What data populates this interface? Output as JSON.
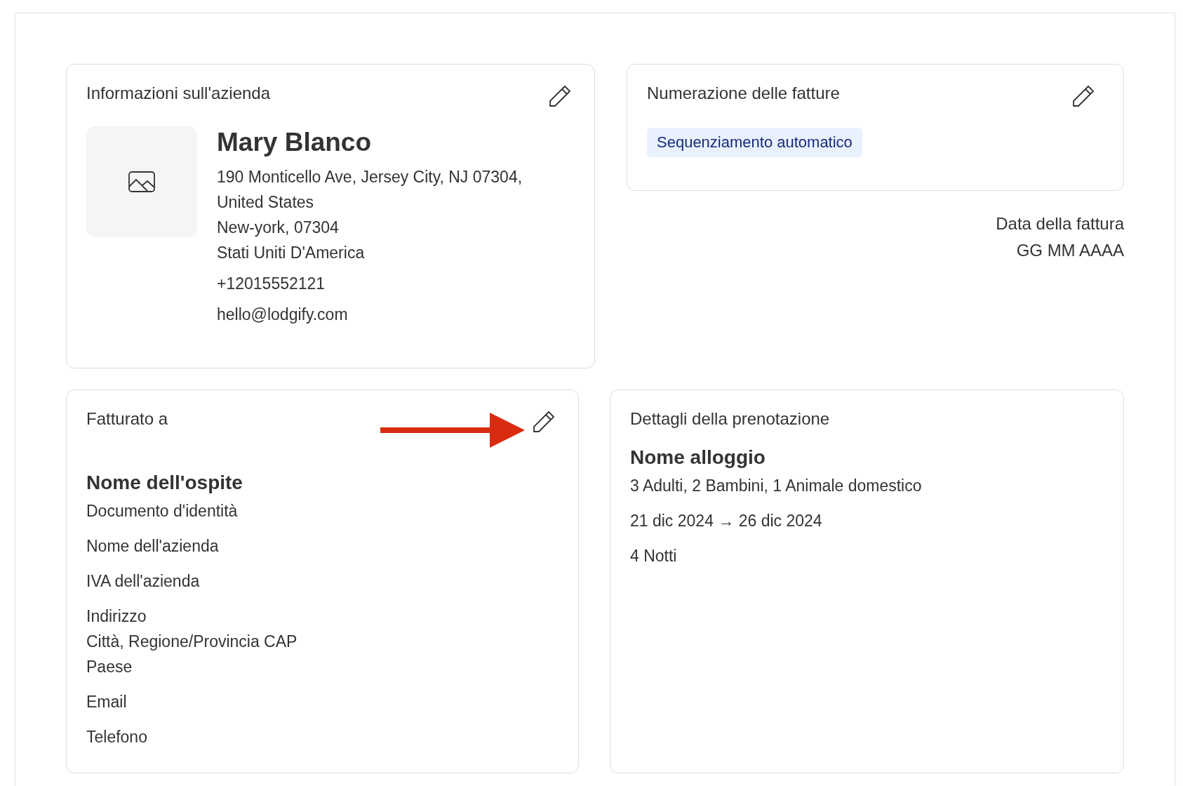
{
  "company_card": {
    "title": "Informazioni sull'azienda",
    "name": "Mary Blanco",
    "address_lines": [
      "190 Monticello Ave, Jersey City, NJ 07304,",
      "United States",
      "New-york, 07304",
      "Stati Uniti D'America"
    ],
    "phone": "+12015552121",
    "email": "hello@lodgify.com"
  },
  "numbering_card": {
    "title": "Numerazione delle fatture",
    "badge": "Sequenziamento automatico"
  },
  "invoice_date": {
    "label": "Data della fattura",
    "value": "GG MM AAAA"
  },
  "billed_to_card": {
    "title": "Fatturato a",
    "name": "Nome dell'ospite",
    "field_groups": [
      [
        "Documento d'identità"
      ],
      [
        "Nome dell'azienda"
      ],
      [
        "IVA dell'azienda"
      ],
      [
        "Indirizzo",
        "Città, Regione/Provincia CAP",
        "Paese"
      ],
      [
        "Email"
      ],
      [
        "Telefono"
      ]
    ]
  },
  "booking_card": {
    "title": "Dettagli della prenotazione",
    "property": "Nome alloggio",
    "lines": [
      "3 Adulti, 2 Bambini, 1 Animale domestico",
      "21 dic 2024 → 26 dic 2024",
      "4 Notti"
    ]
  }
}
